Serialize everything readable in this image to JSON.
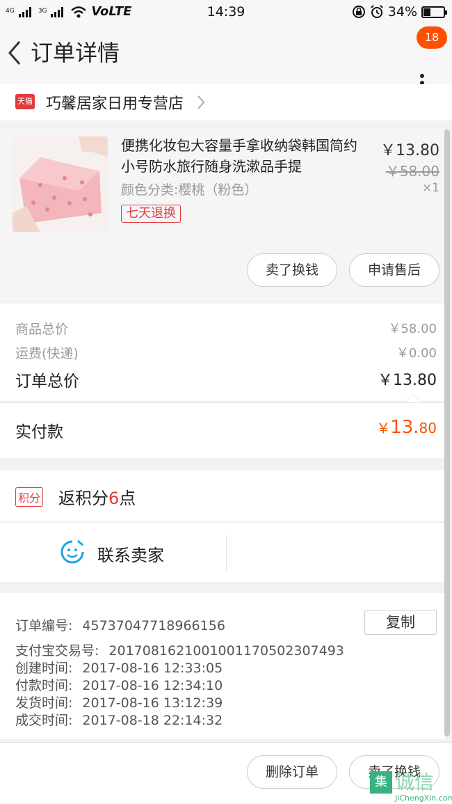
{
  "status_bar": {
    "net1": "4G",
    "net2": "3G",
    "volte": "VoLTE",
    "time": "14:39",
    "battery_percent_label": "34%",
    "battery_level": 0.34
  },
  "header": {
    "title": "订单详情",
    "message_count": "18"
  },
  "store": {
    "badge": "天猫",
    "name": "巧馨居家日用专营店"
  },
  "product": {
    "title": "便携化妆包大容量手拿收纳袋韩国简约小号防水旅行随身洗漱品手提",
    "variant": "颜色分类:樱桃（粉色）",
    "price": "￥13.80",
    "original_price": "￥58.00",
    "quantity": "×1",
    "return_tag": "七天退换",
    "sell_button": "卖了换钱",
    "after_sales_button": "申请售后"
  },
  "totals": {
    "goods_label": "商品总价",
    "goods_value": "￥58.00",
    "shipping_label": "运费(快递)",
    "shipping_value": "￥0.00",
    "order_total_label": "订单总价",
    "order_total_value": "￥13.80",
    "paid_label": "实付款",
    "paid_currency": "￥",
    "paid_int": "13.",
    "paid_dec": "80"
  },
  "points": {
    "tag": "积分",
    "text_prefix": "返积分",
    "num": "6",
    "text_suffix": "点"
  },
  "contact": {
    "label": "联系卖家"
  },
  "order_info": {
    "order_no_label": "订单编号:",
    "order_no": "45737047718966156",
    "copy_button": "复制",
    "alipay_label": "支付宝交易号:",
    "alipay_no": "2017081621001001170502307493",
    "created_label": "创建时间:",
    "created": "2017-08-16 12:33:05",
    "paid_label": "付款时间:",
    "paid": "2017-08-16 12:34:10",
    "shipped_label": "发货时间:",
    "shipped": "2017-08-16 13:12:39",
    "done_label": "成交时间:",
    "done": "2017-08-18 22:14:32"
  },
  "bottom_bar": {
    "delete_button": "删除订单",
    "sell_button": "卖了换钱"
  },
  "watermark": {
    "mark": "集",
    "text": "诚信",
    "sub": "JiChengXin.com"
  },
  "colors": {
    "accent": "#ff5000",
    "tmall_red": "#e4393c",
    "contact_blue": "#1aa3e8"
  }
}
